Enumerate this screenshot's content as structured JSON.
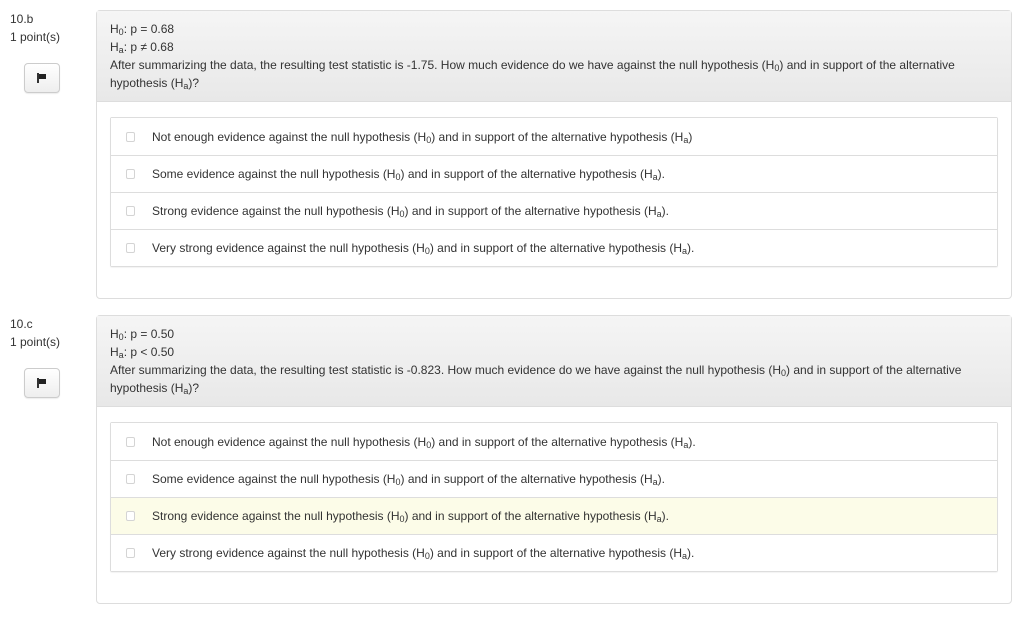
{
  "questions": [
    {
      "number": "10.b",
      "points": "1 point(s)",
      "flag_icon": "flag-icon",
      "stem": {
        "h0_label": "H",
        "h0_sub": "0",
        "h0_rest": ": p = 0.68",
        "ha_label": "H",
        "ha_sub": "a",
        "ha_rest": ": p ≠ 0.68",
        "text_part1": "After summarizing the data, the resulting test statistic is -1.75. How much evidence do we have against the null hypothesis (H",
        "text_sub1": "0",
        "text_part2": ") and in support of the alternative hypothesis (H",
        "text_sub2": "a",
        "text_part3": ")?"
      },
      "options": [
        {
          "pre": "Not enough evidence against the null hypothesis (H",
          "s1": "0",
          "mid": ") and in support of the alternative hypothesis (H",
          "s2": "a",
          "post": ")",
          "checked": false,
          "highlighted": false
        },
        {
          "pre": "Some evidence against the null hypothesis (H",
          "s1": "0",
          "mid": ") and in support of the alternative hypothesis (H",
          "s2": "a",
          "post": ").",
          "checked": false,
          "highlighted": false
        },
        {
          "pre": "Strong evidence against the null hypothesis (H",
          "s1": "0",
          "mid": ") and in support of the alternative hypothesis (H",
          "s2": "a",
          "post": ").",
          "checked": false,
          "highlighted": false
        },
        {
          "pre": "Very strong evidence against the null hypothesis (H",
          "s1": "0",
          "mid": ") and in support of the alternative hypothesis (H",
          "s2": "a",
          "post": ").",
          "checked": false,
          "highlighted": false
        }
      ]
    },
    {
      "number": "10.c",
      "points": "1 point(s)",
      "flag_icon": "flag-icon",
      "stem": {
        "h0_label": "H",
        "h0_sub": "0",
        "h0_rest": ": p = 0.50",
        "ha_label": "H",
        "ha_sub": "a",
        "ha_rest": ": p < 0.50",
        "text_part1": "After summarizing the data, the resulting test statistic is -0.823. How much evidence do we have against the null hypothesis (H",
        "text_sub1": "0",
        "text_part2": ") and in support of the alternative hypothesis (H",
        "text_sub2": "a",
        "text_part3": ")?"
      },
      "options": [
        {
          "pre": "Not enough evidence against the null hypothesis (H",
          "s1": "0",
          "mid": ") and in support of the alternative hypothesis (H",
          "s2": "a",
          "post": ").",
          "checked": false,
          "highlighted": false
        },
        {
          "pre": "Some evidence against the null hypothesis (H",
          "s1": "0",
          "mid": ") and in support of the alternative hypothesis (H",
          "s2": "a",
          "post": ").",
          "checked": false,
          "highlighted": false
        },
        {
          "pre": "Strong evidence against the null hypothesis (H",
          "s1": "0",
          "mid": ") and in support of the alternative hypothesis (H",
          "s2": "a",
          "post": ").",
          "checked": false,
          "highlighted": true
        },
        {
          "pre": "Very strong evidence against the null hypothesis (H",
          "s1": "0",
          "mid": ") and in support of the alternative hypothesis (H",
          "s2": "a",
          "post": ").",
          "checked": false,
          "highlighted": false
        }
      ]
    }
  ],
  "colors": {
    "highlight_row": "#fcfce8",
    "border": "#dddddd",
    "text": "#333333"
  }
}
